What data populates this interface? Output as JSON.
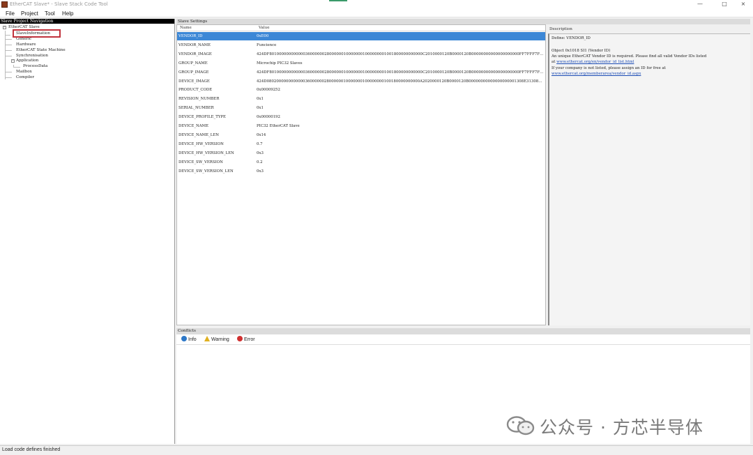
{
  "window": {
    "title": "EtherCAT Slave* - Slave Stack Code Tool",
    "controls": {
      "minimize": "—",
      "maximize": "□",
      "close": "×"
    }
  },
  "menu": [
    "File",
    "Project",
    "Tool",
    "Help"
  ],
  "nav": {
    "header": "Slave Project Navigation",
    "root": "EtherCAT Slave",
    "items": [
      "SlaveInformation",
      "Generic",
      "Hardware",
      "EtherCAT State Machine",
      "Synchronisation",
      "Application",
      "ProcessData",
      "Mailbox",
      "Compiler"
    ]
  },
  "settings": {
    "header": "Slave Settings",
    "columns": {
      "name": "Name",
      "value": "Value"
    },
    "rows": [
      {
        "name": "VENDOR_ID",
        "value": "0xE00"
      },
      {
        "name": "VENDOR_NAME",
        "value": "Funcience"
      },
      {
        "name": "VENDOR_IMAGE",
        "value": "424DF8010000000000003600000028000000100000001000000001001800000000000C2010000120B0000120B00000000000000000000FF7FFF7FFF7..."
      },
      {
        "name": "GROUP_NAME",
        "value": "Microchip PIC32 Slaves"
      },
      {
        "name": "GROUP_IMAGE",
        "value": "424DF8010000000000003600000028000000100000001000000001001800000000000C2010000120B0000120B00000000000000000000FF7FFF7FFF7..."
      },
      {
        "name": "DEVICE_IMAGE",
        "value": "424D0802000000000000360000002800000010000000100000000100180000000000A2020000120B0000120B00000000000000000001308E31308E..."
      },
      {
        "name": "PRODUCT_CODE",
        "value": "0x00009252"
      },
      {
        "name": "REVISION_NUMBER",
        "value": "0x1"
      },
      {
        "name": "SERIAL_NUMBER",
        "value": "0x1"
      },
      {
        "name": "DEVICE_PROFILE_TYPE",
        "value": "0x00000192"
      },
      {
        "name": "DEVICE_NAME",
        "value": "PIC32 EtherCAT Slave"
      },
      {
        "name": "DEVICE_NAME_LEN",
        "value": "0x14"
      },
      {
        "name": "DEVICE_HW_VERSION",
        "value": "0.7"
      },
      {
        "name": "DEVICE_HW_VERSION_LEN",
        "value": "0x3"
      },
      {
        "name": "DEVICE_SW_VERSION",
        "value": "0.2"
      },
      {
        "name": "DEVICE_SW_VERSION_LEN",
        "value": "0x3"
      }
    ]
  },
  "description": {
    "header": "Description",
    "line1": "Define: VENDOR_ID",
    "line2": "Object 0x1018 SI1 (Vendor ID)",
    "line3": "An unique EtherCAT Vendor ID is required. Please find all valid Vendor IDs listed",
    "line4_prefix": "at",
    "link1": "www.ethercat.org/en/vendor_id_list.html",
    "line5": "If your company is not listed, please assign an ID for free at",
    "link2": "www.ethercat.org/memberarea/vendor_id.aspx"
  },
  "conflicts": {
    "header": "Conflicts",
    "tabs": {
      "info": "Info",
      "warning": "Warning",
      "error": "Error"
    }
  },
  "watermark": "公众号 · 方芯半导体",
  "status": "Load code defines finished",
  "colors": {
    "selection": "#3c87d6",
    "highlight_box": "#c0323c",
    "link": "#1a4bb5"
  }
}
